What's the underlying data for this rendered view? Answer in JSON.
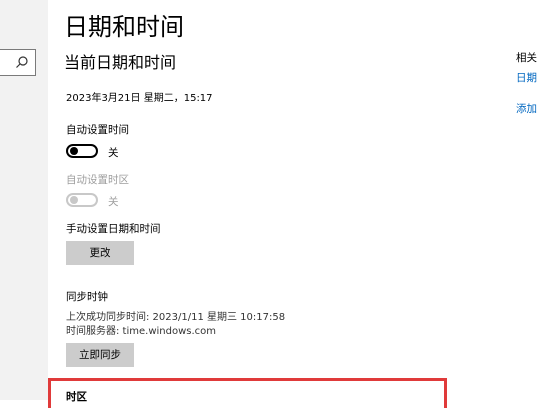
{
  "page_title": "日期和时间",
  "section_title": "当前日期和时间",
  "current_datetime": "2023年3月21日 星期二，15:17",
  "auto_time": {
    "label": "自动设置时间",
    "state": "关"
  },
  "auto_timezone": {
    "label": "自动设置时区",
    "state": "关"
  },
  "manual_set": {
    "label": "手动设置日期和时间",
    "button": "更改"
  },
  "sync": {
    "heading": "同步时钟",
    "last_sync": "上次成功同步时间: 2023/1/11 星期三 10:17:58",
    "server": "时间服务器: time.windows.com",
    "button": "立即同步"
  },
  "timezone": {
    "label": "时区"
  },
  "related": {
    "heading": "相关",
    "link1": "日期",
    "link2": "添加"
  },
  "colors": {
    "highlight": "#e03a3a",
    "link": "#0067c0",
    "button_bg": "#cccccc"
  }
}
